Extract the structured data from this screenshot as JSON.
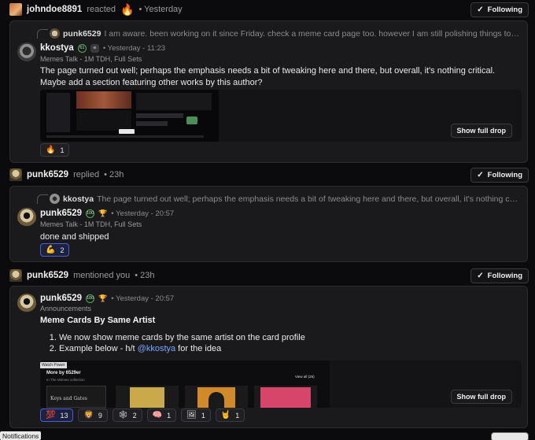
{
  "notifications": [
    {
      "user": "johndoe8891",
      "action": "reacted",
      "reaction_icon": "fire-icon",
      "time": "• Yesterday",
      "follow_label": "Following",
      "quote": {
        "user": "punk6529",
        "text": "I am aware. been working on it since Friday. check a meme card page too. however I am still polishing things to get v1 the way..."
      },
      "post": {
        "user": "kkostya",
        "badge": "61",
        "time": "• Yesterday - 11:23",
        "sub": "Memes Talk - 1M TDH, Full Sets",
        "text": "The page turned out well; perhaps the emphasis needs a bit of tweaking here and there, but overall, it's nothing critical. Maybe add a section featuring other works by this author?",
        "show_drop_label": "Show full drop",
        "reactions": [
          {
            "emoji": "🔥",
            "count": "1"
          }
        ]
      }
    },
    {
      "user": "punk6529",
      "action": "replied",
      "time": "• 23h",
      "follow_label": "Following",
      "quote": {
        "user": "kkostya",
        "text": "The page turned out well; perhaps the emphasis needs a bit of tweaking here and there, but overall, it's nothing critical. Maybe..."
      },
      "post": {
        "user": "punk6529",
        "badge": "100",
        "time": "• Yesterday - 20:57",
        "sub": "Memes Talk - 1M TDH, Full Sets",
        "text": "done and shipped",
        "reactions": [
          {
            "emoji": "💪",
            "count": "2"
          }
        ]
      }
    },
    {
      "user": "punk6529",
      "action": "mentioned you",
      "time": "• 23h",
      "follow_label": "Following",
      "post": {
        "user": "punk6529",
        "badge": "100",
        "time": "• Yesterday - 20:57",
        "sub": "Announcements",
        "title": "Meme Cards By Same Artist",
        "list_1": "We now show meme cards by the same artist on the card profile",
        "list_2_prefix": "Example below - h/t ",
        "list_2_mention": "@kkostya",
        "list_2_suffix": " for the idea",
        "show_drop_label": "Show full drop",
        "preview": {
          "tag": "Watch Power",
          "heading": "More by 6529er",
          "sub": "In The Memes collection",
          "view_all": "View all (25)",
          "card_title": "Keys and Gates"
        },
        "reactions": [
          {
            "emoji": "💯",
            "count": "13"
          },
          {
            "emoji": "🦁",
            "count": "9"
          },
          {
            "emoji": "🕸",
            "count": "2"
          },
          {
            "emoji": "🧠",
            "count": "1"
          },
          {
            "emoji": "🖼",
            "count": "1"
          },
          {
            "emoji": "🤘",
            "count": "1"
          }
        ]
      }
    }
  ],
  "tooltip": "Notifications",
  "colors": {
    "accent": "#4a5fd6",
    "mention": "#7aa7ff",
    "badge_green": "#4caf50"
  }
}
